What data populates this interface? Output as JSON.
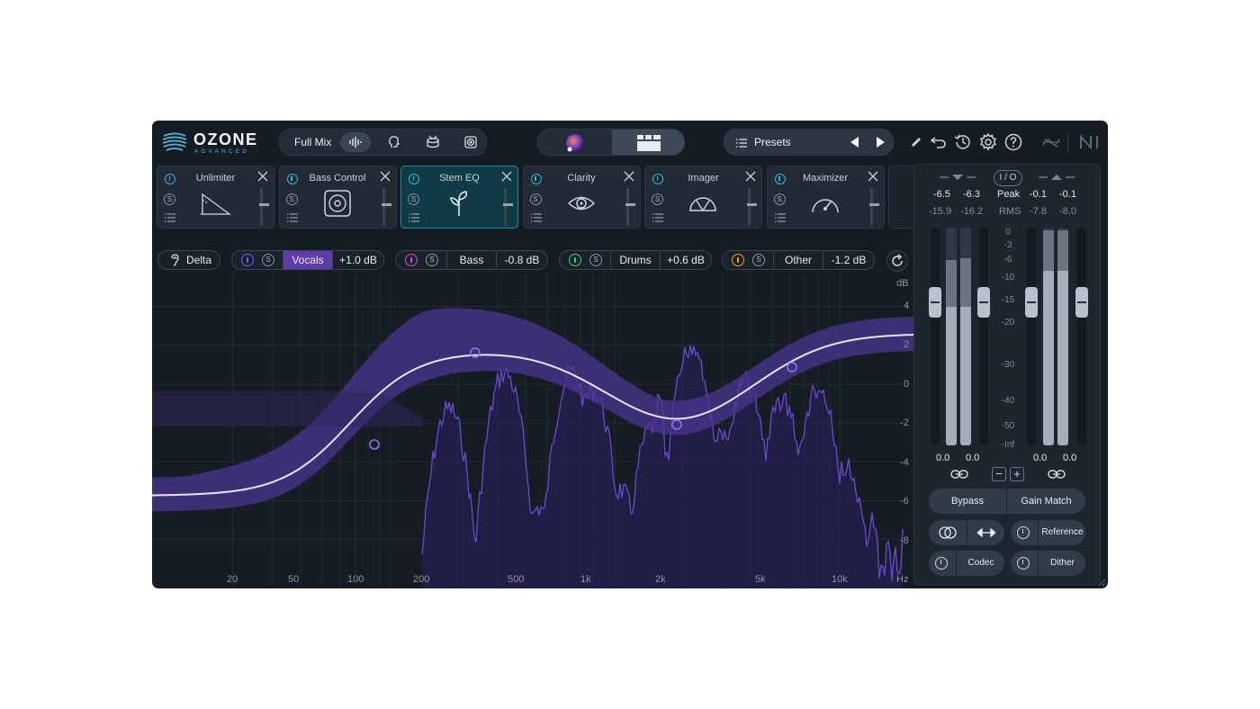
{
  "app": {
    "logo_name": "OZONE",
    "logo_sub": "ADVANCED"
  },
  "topbar": {
    "mix_label": "Full Mix",
    "mix_modes": [
      "waveform-icon",
      "vocal-head-icon",
      "drum-icon",
      "speaker-icon"
    ],
    "presets_label": "Presets",
    "tools": [
      "pencil-icon",
      "undo-icon",
      "history-icon",
      "gear-icon",
      "help-icon",
      "signal-chain-icon",
      "ni-logo"
    ]
  },
  "modules": [
    {
      "title": "Unlimiter",
      "icon": "unlimiter-icon",
      "selected": false
    },
    {
      "title": "Bass Control",
      "icon": "bass-control-icon",
      "selected": false
    },
    {
      "title": "Stem EQ",
      "icon": "stem-eq-icon",
      "selected": true
    },
    {
      "title": "Clarity",
      "icon": "clarity-icon",
      "selected": false
    },
    {
      "title": "Imager",
      "icon": "imager-icon",
      "selected": false
    },
    {
      "title": "Maximizer",
      "icon": "maximizer-icon",
      "selected": false
    }
  ],
  "stems": {
    "delta_label": "Delta",
    "items": [
      {
        "name": "Vocals",
        "gain": "+1.0 dB",
        "color": "#7b5cf0",
        "active": true
      },
      {
        "name": "Bass",
        "gain": "-0.8 dB",
        "color": "#e04bd2",
        "active": false
      },
      {
        "name": "Drums",
        "gain": "+0.6 dB",
        "color": "#3fcf7a",
        "active": false
      },
      {
        "name": "Other",
        "gain": "-1.2 dB",
        "color": "#f0a030",
        "active": false
      }
    ]
  },
  "eq": {
    "db_unit": "dB",
    "db_ticks": [
      "4",
      "2",
      "0",
      "-2",
      "-4",
      "-6",
      "-8"
    ],
    "hz_ticks": [
      "20",
      "50",
      "100",
      "200",
      "500",
      "1k",
      "2k",
      "5k",
      "10k"
    ],
    "hz_unit": "Hz",
    "colors": {
      "curve": "#e9e4f4",
      "band": "#4a3690",
      "spectrum": "#6a4bd0",
      "node": "#8b76f0"
    }
  },
  "meters": {
    "io_label": "I / O",
    "input_peak": [
      "-6.5",
      "-6.3"
    ],
    "input_rms": [
      "-15.9",
      "-16.2"
    ],
    "output_peak": [
      "-0.1",
      "-0.1"
    ],
    "output_rms": [
      "-7.8",
      "-8.0"
    ],
    "peak_label": "Peak",
    "rms_label": "RMS",
    "scale": [
      "0",
      "-3",
      "-6",
      "-10",
      "-15",
      "-20",
      "-30",
      "-40",
      "-50",
      "-Inf"
    ],
    "input_gain": [
      "0.0",
      "0.0"
    ],
    "output_gain": [
      "0.0",
      "0.0"
    ],
    "minus": "−",
    "plus": "+"
  },
  "buttons": {
    "bypass": "Bypass",
    "gain_match": "Gain Match",
    "reference": "Reference",
    "codec": "Codec",
    "dither": "Dither"
  }
}
